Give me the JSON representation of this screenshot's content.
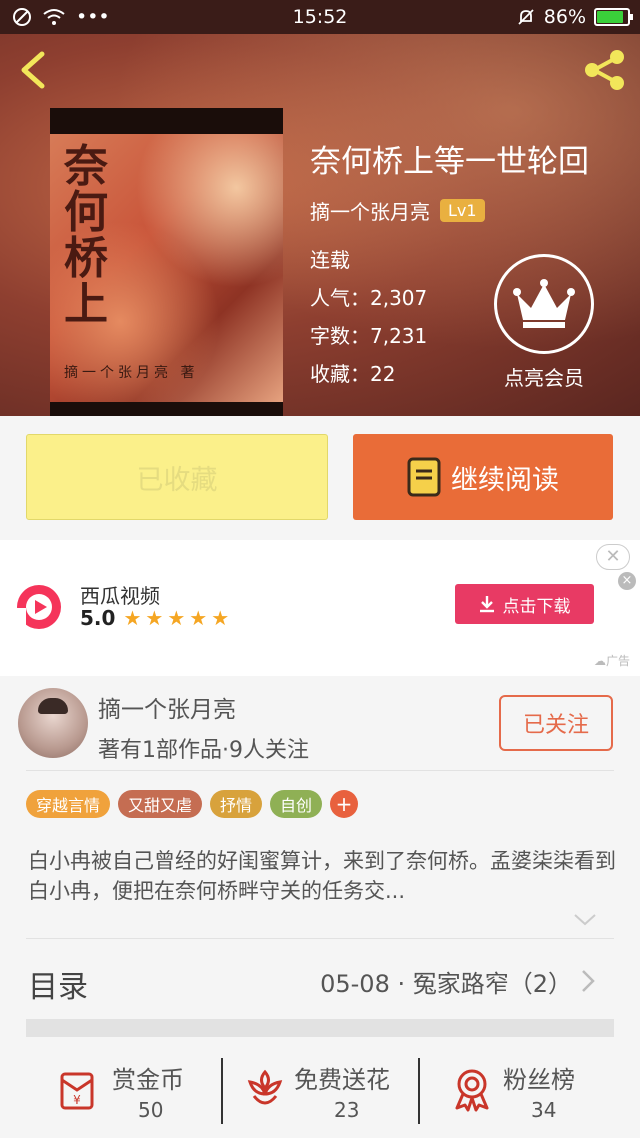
{
  "status_bar": {
    "time": "15:52",
    "battery": "86%",
    "battery_level": 0.86,
    "dots": "•••"
  },
  "book": {
    "title": "奈何桥上等一世轮回",
    "author": "摘一个张月亮",
    "level": "Lv1",
    "status": "连载",
    "popularity": "人气：2,307",
    "word_count": "字数：7,231",
    "favorites": "收藏：22",
    "cover_title": "奈何桥上",
    "cover_author": "摘一个张月亮 著"
  },
  "vip": {
    "label": "点亮会员"
  },
  "actions": {
    "collected_label": "已收藏",
    "read_label": "继续阅读"
  },
  "ad": {
    "app_name": "西瓜视频",
    "score": "5.0",
    "stars": 5,
    "download_label": "点击下载",
    "ad_tag": "广告",
    "close_glyph": "✕",
    "x_glyph": "×"
  },
  "author_section": {
    "name": "摘一个张月亮",
    "meta": "著有1部作品·9人关注",
    "follow_label": "已关注"
  },
  "tags": [
    {
      "label": "穿越言情",
      "color": "#f0a23c"
    },
    {
      "label": "又甜又虐",
      "color": "#c56d52"
    },
    {
      "label": "抒情",
      "color": "#d8a23c"
    },
    {
      "label": "自创",
      "color": "#8fb055"
    }
  ],
  "tag_plus": "+",
  "description": "白小冉被自己曾经的好闺蜜算计，来到了奈何桥。孟婆柒柒看到白小冉，便把在奈何桥畔守关的任务交...",
  "catalog": {
    "title": "目录",
    "latest": "05-08 · 冤家路窄（2）"
  },
  "stats": [
    {
      "label": "赏金币",
      "value": "50"
    },
    {
      "label": "免费送花",
      "value": "23"
    },
    {
      "label": "粉丝榜",
      "value": "34"
    }
  ],
  "colors": {
    "accent": "#e96c38",
    "collected_bg": "#fbf08a",
    "ad_button": "#e83a64",
    "icon_red": "#c9362a"
  }
}
